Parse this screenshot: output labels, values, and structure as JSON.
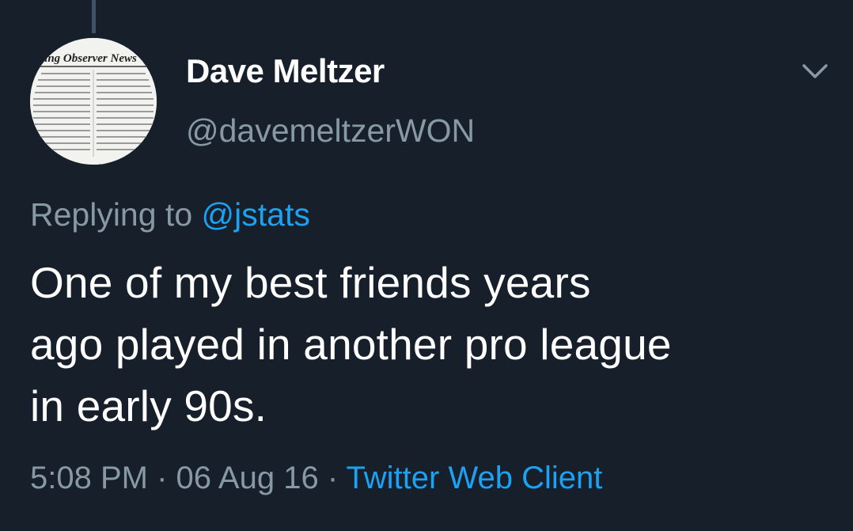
{
  "tweet": {
    "author": {
      "display_name": "Dave Meltzer",
      "handle": "@davemeltzerWON",
      "avatar_icon": "newsletter-avatar",
      "avatar_banner_text": "ling Observer News"
    },
    "menu_icon": "chevron-down-icon",
    "reply": {
      "prefix": "Replying to ",
      "mention": "@jstats"
    },
    "text_lines": [
      "One of my best friends years",
      "ago played in another pro league",
      "in early 90s."
    ],
    "meta": {
      "time": "5:08 PM",
      "separator": " · ",
      "date": "06 Aug 16",
      "client": "Twitter Web Client"
    }
  },
  "colors": {
    "background": "#161f2a",
    "text_primary": "#ffffff",
    "text_secondary": "#8899a6",
    "link": "#1da1f2",
    "thread_line": "#3d5466"
  }
}
